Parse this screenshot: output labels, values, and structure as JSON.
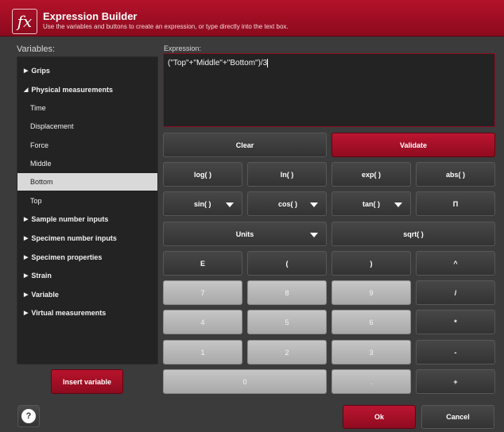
{
  "header": {
    "icon": "fx-icon",
    "icon_text": "fx",
    "title": "Expression Builder",
    "subtitle": "Use the variables and buttons to create an expression, or type directly into the text box."
  },
  "variables": {
    "label": "Variables:",
    "items": [
      {
        "label": "Grips",
        "expanded": false
      },
      {
        "label": "Physical measurements",
        "expanded": true
      },
      {
        "label": "Time"
      },
      {
        "label": "Displacement"
      },
      {
        "label": "Force"
      },
      {
        "label": "Middle"
      },
      {
        "label": "Bottom",
        "selected": true
      },
      {
        "label": "Top"
      },
      {
        "label": "Sample number inputs",
        "expanded": false
      },
      {
        "label": "Specimen number inputs",
        "expanded": false
      },
      {
        "label": "Specimen properties",
        "expanded": false
      },
      {
        "label": "Strain",
        "expanded": false
      },
      {
        "label": "Variable",
        "expanded": false
      },
      {
        "label": "Virtual measurements",
        "expanded": false
      }
    ],
    "insert_label": "Insert variable"
  },
  "expression": {
    "label": "Expression:",
    "value": "(\"Top\"+\"Middle\"+\"Bottom\")/3"
  },
  "buttons": {
    "clear": "Clear",
    "validate": "Validate",
    "log": "log( )",
    "ln": "ln( )",
    "exp": "exp( )",
    "abs": "abs( )",
    "sin": "sin( )",
    "cos": "cos( )",
    "tan": "tan( )",
    "pi": "Π",
    "units": "Units",
    "sqrt": "sqrt( )",
    "e": "E",
    "lparen": "(",
    "rparen": ")",
    "power": "^",
    "n7": "7",
    "n8": "8",
    "n9": "9",
    "divide": "/",
    "n4": "4",
    "n5": "5",
    "n6": "6",
    "multiply": "*",
    "n1": "1",
    "n2": "2",
    "n3": "3",
    "minus": "-",
    "n0": "0",
    "dot": ".",
    "plus": "+"
  },
  "footer": {
    "help": "?",
    "ok": "Ok",
    "cancel": "Cancel"
  },
  "colors": {
    "accent": "#a8102a",
    "panel": "#232323",
    "frame": "#3b3b3b"
  }
}
